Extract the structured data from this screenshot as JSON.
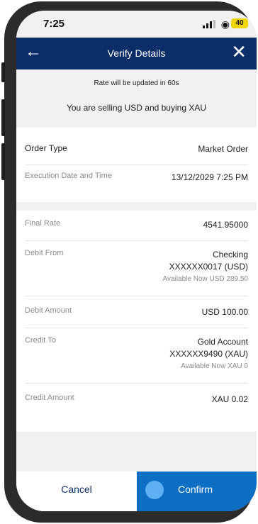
{
  "status_bar": {
    "time": "7:25",
    "battery": "40"
  },
  "nav": {
    "title": "Verify Details"
  },
  "banner": {
    "rate_notice": "Rate will be updated in 60s",
    "summary": "You are selling USD and buying XAU"
  },
  "order": {
    "type_label": "Order Type",
    "type_value": "Market Order",
    "exec_label": "Execution Date and Time",
    "exec_value": "13/12/2029 7:25 PM"
  },
  "details": {
    "final_rate_label": "Final Rate",
    "final_rate_value": "4541.95000",
    "debit_from_label": "Debit From",
    "debit_from_account": "Checking",
    "debit_from_number": "XXXXXX0017 (USD)",
    "debit_from_available": "Available Now USD 289.50",
    "debit_amount_label": "Debit Amount",
    "debit_amount_value": "USD 100.00",
    "credit_to_label": "Credit To",
    "credit_to_account": "Gold Account",
    "credit_to_number": "XXXXXX9490 (XAU)",
    "credit_to_available": "Available Now XAU 0",
    "credit_amount_label": "Credit Amount",
    "credit_amount_value": "XAU 0.02"
  },
  "footer": {
    "cancel_label": "Cancel",
    "confirm_label": "Confirm"
  }
}
